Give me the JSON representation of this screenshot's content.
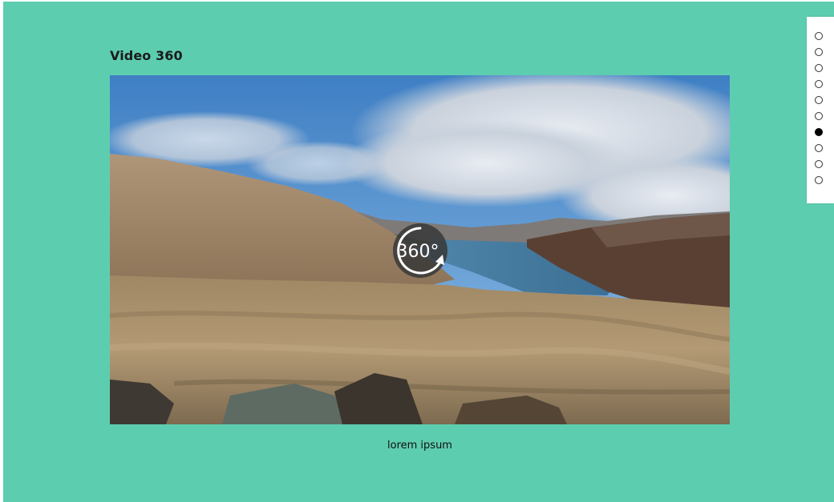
{
  "page": {
    "title": "Video 360",
    "caption": "lorem ipsum",
    "background_color": "#5dcdb0"
  },
  "video": {
    "badge_text": "360°",
    "badge_icon": "360-rotate-icon"
  },
  "dot_nav": {
    "count": 10,
    "active_index": 6
  }
}
